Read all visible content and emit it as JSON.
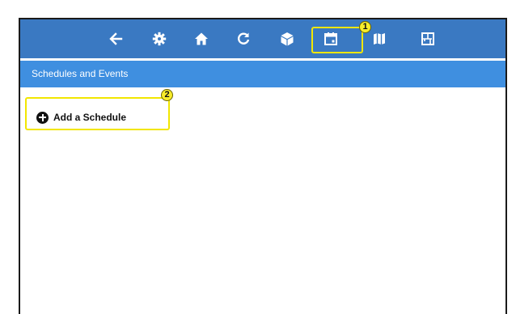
{
  "toolbar": {
    "icons": [
      "back-arrow-icon",
      "gear-icon",
      "home-icon",
      "refresh-icon",
      "cube-icon",
      "calendar-icon",
      "map-icon",
      "floorplan-icon"
    ]
  },
  "callouts": {
    "one": "1",
    "two": "2"
  },
  "section": {
    "title": "Schedules and Events"
  },
  "actions": {
    "add_schedule_label": "Add a Schedule"
  },
  "colors": {
    "toolbar_bg": "#3a79c2",
    "subheader_bg": "#3f8fe0",
    "highlight": "#f2e600"
  }
}
